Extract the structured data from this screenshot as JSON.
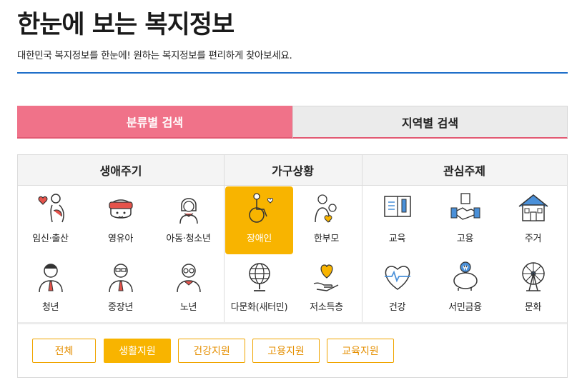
{
  "page": {
    "title": "한눈에 보는 복지정보",
    "subtitle": "대한민국 복지정보를 한눈에! 원하는 복지정보를 편리하게 찾아보세요."
  },
  "tabs": [
    {
      "label": "분류별 검색",
      "active": true
    },
    {
      "label": "지역별 검색",
      "active": false
    }
  ],
  "categories": {
    "life_cycle": {
      "heading": "생애주기",
      "items": [
        {
          "label": "임신·출산",
          "icon": "pregnancy-icon"
        },
        {
          "label": "영유아",
          "icon": "infant-icon"
        },
        {
          "label": "아동·청소년",
          "icon": "child-icon"
        },
        {
          "label": "청년",
          "icon": "youth-icon"
        },
        {
          "label": "중장년",
          "icon": "middle-aged-icon"
        },
        {
          "label": "노년",
          "icon": "senior-icon"
        }
      ]
    },
    "household": {
      "heading": "가구상황",
      "items": [
        {
          "label": "장애인",
          "icon": "wheelchair-icon",
          "selected": true
        },
        {
          "label": "한부모",
          "icon": "single-parent-icon"
        },
        {
          "label": "다문화(새터민)",
          "icon": "globe-icon"
        },
        {
          "label": "저소득층",
          "icon": "heart-hand-icon"
        }
      ]
    },
    "interest": {
      "heading": "관심주제",
      "items": [
        {
          "label": "교육",
          "icon": "book-icon"
        },
        {
          "label": "고용",
          "icon": "handshake-icon"
        },
        {
          "label": "주거",
          "icon": "house-icon"
        },
        {
          "label": "건강",
          "icon": "heartbeat-icon"
        },
        {
          "label": "서민금융",
          "icon": "piggy-bank-icon"
        },
        {
          "label": "문화",
          "icon": "ferris-wheel-icon"
        }
      ]
    }
  },
  "filters": [
    {
      "label": "전체",
      "active": false
    },
    {
      "label": "생활지원",
      "active": true
    },
    {
      "label": "건강지원",
      "active": false
    },
    {
      "label": "고용지원",
      "active": false
    },
    {
      "label": "교육지원",
      "active": false
    }
  ],
  "colors": {
    "accent_pink": "#f07289",
    "accent_yellow": "#f8b400",
    "rule_blue": "#1f6fc9"
  }
}
